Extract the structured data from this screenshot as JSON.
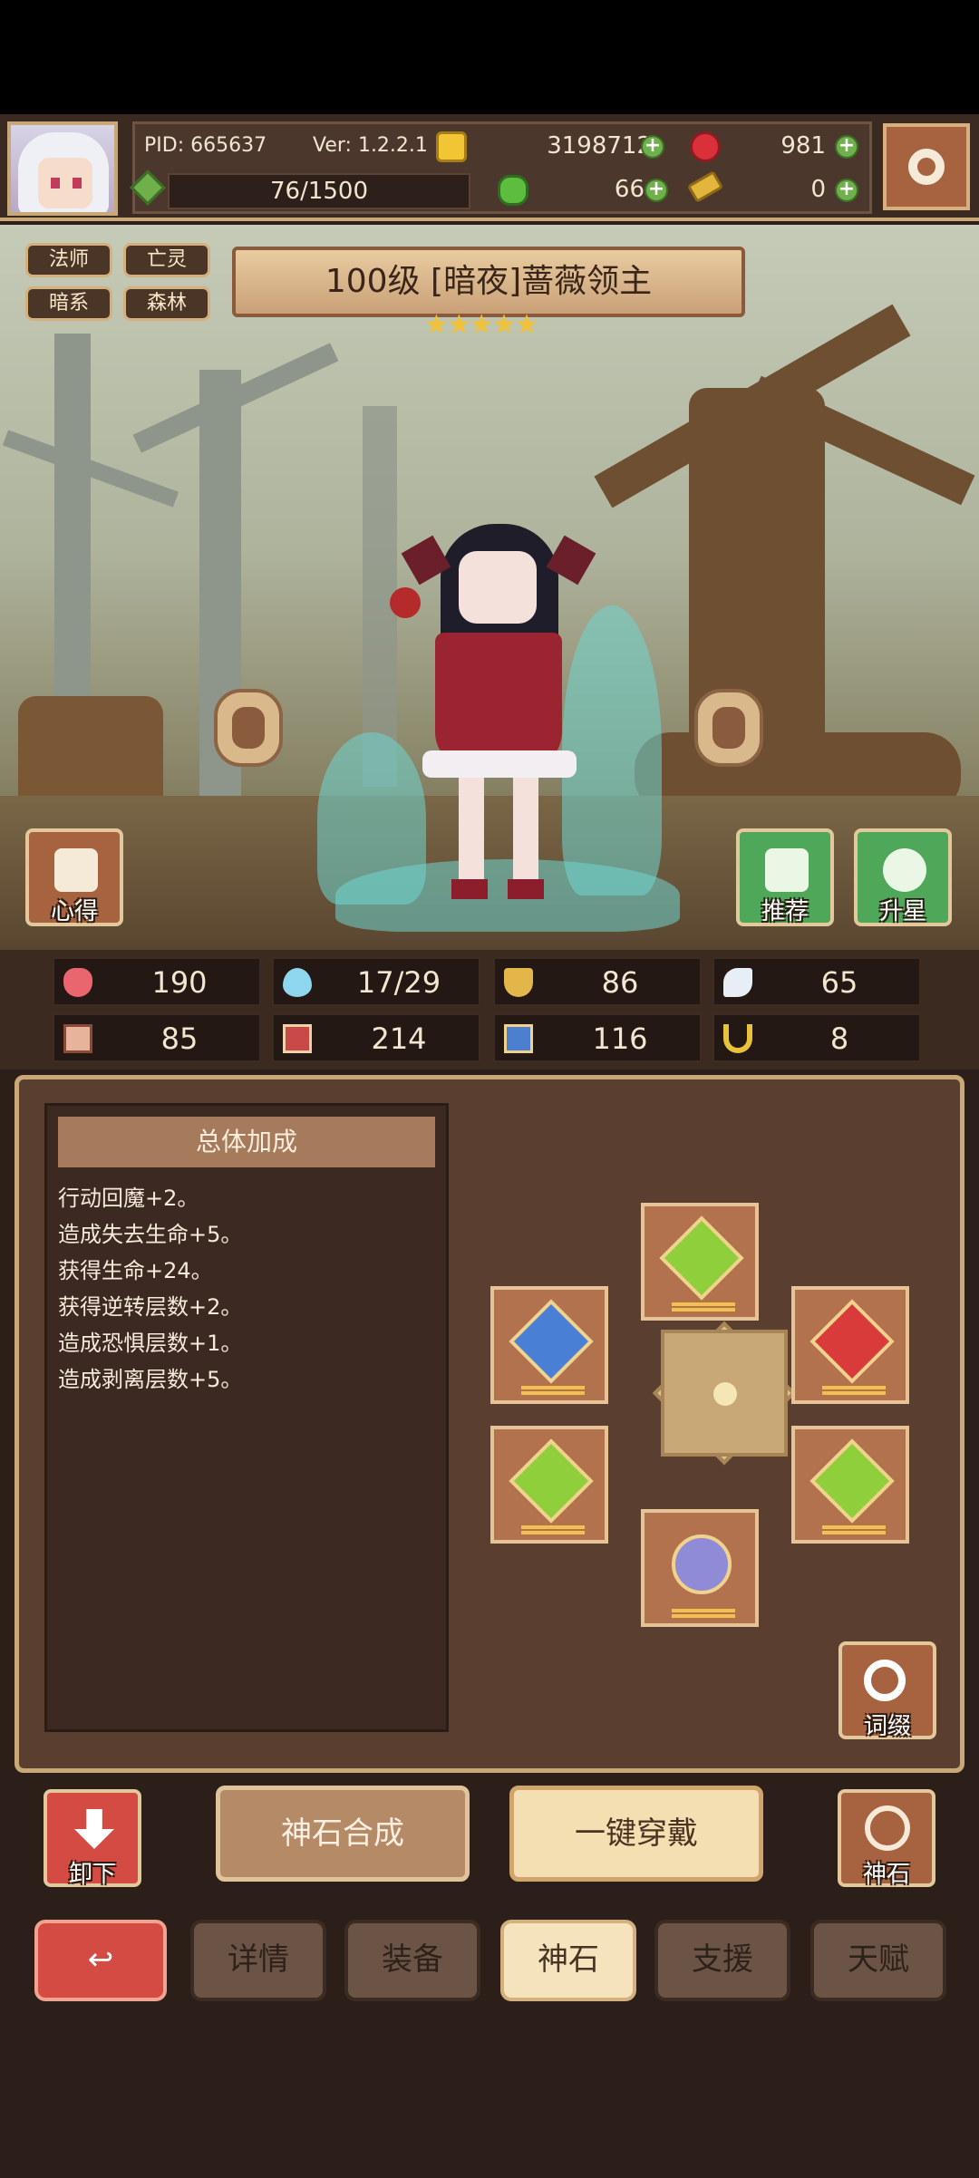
{
  "header": {
    "pid": "PID: 665637",
    "version": "Ver: 1.2.2.1",
    "gold": "3198712",
    "ruby": "981",
    "energy": "76/1500",
    "clover": "66",
    "key": "0"
  },
  "character": {
    "tags": [
      "法师",
      "亡灵",
      "暗系",
      "森林"
    ],
    "title": "100级 [暗夜]蔷薇领主",
    "stars": "★★★★★"
  },
  "side_buttons": {
    "notes": "心得",
    "recommend": "推荐",
    "star_up": "升星"
  },
  "stats": [
    {
      "icon": "heart-icon",
      "value": "190"
    },
    {
      "icon": "mana-drop-icon",
      "value": "17/29"
    },
    {
      "icon": "shield-icon",
      "value": "86"
    },
    {
      "icon": "wing-icon",
      "value": "65"
    },
    {
      "icon": "fist-icon",
      "value": "85"
    },
    {
      "icon": "book-icon",
      "value": "214"
    },
    {
      "icon": "boot-icon",
      "value": "116"
    },
    {
      "icon": "horseshoe-icon",
      "value": "8"
    }
  ],
  "bonus": {
    "title": "总体加成",
    "lines": [
      "行动回魔+2。",
      "造成失去生命+5。",
      "获得生命+24。",
      "获得逆转层数+2。",
      "造成恐惧层数+1。",
      "造成剥离层数+5。"
    ]
  },
  "gem_panel": {
    "affix_label": "词缀",
    "unequip_label": "卸下",
    "synth_label": "神石合成",
    "equip_all_label": "一键穿戴",
    "godstone_label": "神石"
  },
  "tabs": {
    "back": "↩",
    "items": [
      "详情",
      "装备",
      "神石",
      "支援",
      "天赋"
    ],
    "active": "神石"
  },
  "colors": {
    "accent": "#c9a877",
    "panel": "#5a3f31",
    "gem_green": "#8fcf3c",
    "gem_red": "#d93a3a",
    "gem_blue": "#4a7fd6",
    "gem_purple": "#8f8bd6"
  }
}
